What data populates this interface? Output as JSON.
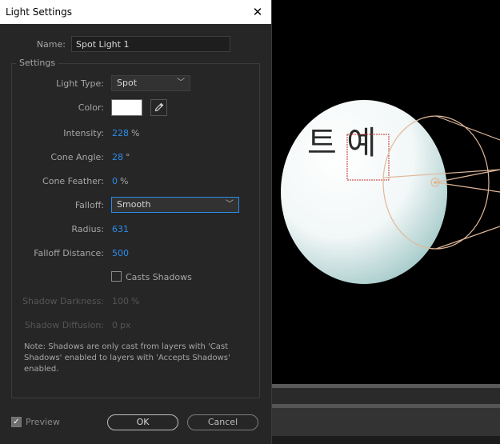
{
  "dialog": {
    "title": "Light Settings",
    "close_glyph": "✕",
    "name_label": "Name:",
    "name_value": "Spot Light 1",
    "settings_legend": "Settings",
    "light_type_label": "Light Type:",
    "light_type_value": "Spot",
    "color_label": "Color:",
    "color_value": "#ffffff",
    "intensity_label": "Intensity:",
    "intensity_value": "228",
    "intensity_unit": "%",
    "cone_angle_label": "Cone Angle:",
    "cone_angle_value": "28",
    "cone_angle_unit": "°",
    "cone_feather_label": "Cone Feather:",
    "cone_feather_value": "0",
    "cone_feather_unit": "%",
    "falloff_label": "Falloff:",
    "falloff_value": "Smooth",
    "radius_label": "Radius:",
    "radius_value": "631",
    "falloff_distance_label": "Falloff Distance:",
    "falloff_distance_value": "500",
    "casts_shadows_label": "Casts Shadows",
    "shadow_darkness_label": "Shadow Darkness:",
    "shadow_darkness_value": "100",
    "shadow_darkness_unit": "%",
    "shadow_diffusion_label": "Shadow Diffusion:",
    "shadow_diffusion_value": "0",
    "shadow_diffusion_unit": "px",
    "note": "Note: Shadows are only cast from layers with 'Cast Shadows' enabled to layers with 'Accepts Shadows' enabled.",
    "preview_label": "Preview",
    "ok_label": "OK",
    "cancel_label": "Cancel"
  },
  "viewport": {
    "layer_text": "트 예",
    "light_gizmo_color": "#e0b89a",
    "selection_color": "#c0302a"
  },
  "colors": {
    "accent": "#2d8ceb",
    "dialog_bg": "#262626"
  },
  "icons": {
    "eyedropper": "eyedropper-icon",
    "chevron": "chevron-down-icon",
    "close": "close-icon",
    "check": "check-icon"
  }
}
